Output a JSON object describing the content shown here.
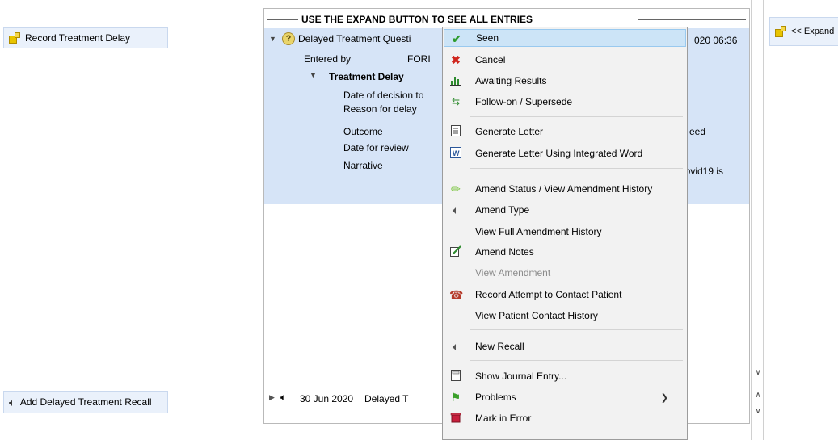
{
  "left_buttons": {
    "record_treatment_delay": "Record Treatment Delay",
    "add_delayed_treatment_recall": "Add Delayed Treatment Recall"
  },
  "right_button": {
    "expand": "<< Expand"
  },
  "panel": {
    "header": "USE THE EXPAND BUTTON TO SEE ALL ENTRIES",
    "entry": {
      "title": "Delayed Treatment Questi",
      "time_fragment": "020 06:36",
      "entered_by_label": "Entered by",
      "entered_by_value": "FORI",
      "section_title": "Treatment Delay",
      "fields": [
        {
          "label": "Date of decision to",
          "value": ""
        },
        {
          "label": "Reason for delay",
          "value": ""
        },
        {
          "label": "Outcome",
          "value": "eed"
        },
        {
          "label": "Date for review",
          "value": ""
        },
        {
          "label": "Narrative",
          "value": "f covid19 is"
        }
      ]
    },
    "bottom_row": {
      "date": "30 Jun 2020",
      "text": "Delayed T"
    }
  },
  "context_menu": {
    "items": [
      {
        "label": "Seen",
        "icon": "check-icon",
        "highlighted": true,
        "disabled": false
      },
      {
        "label": "Cancel",
        "icon": "cross-icon",
        "highlighted": false,
        "disabled": false
      },
      {
        "label": "Awaiting Results",
        "icon": "chart-icon",
        "highlighted": false,
        "disabled": false
      },
      {
        "label": "Follow-on / Supersede",
        "icon": "arrows-icon",
        "highlighted": false,
        "disabled": false
      },
      {
        "label": "Generate Letter",
        "icon": "document-icon",
        "highlighted": false,
        "disabled": false
      },
      {
        "label": "Generate Letter Using Integrated Word",
        "icon": "word-icon",
        "highlighted": false,
        "disabled": false
      },
      {
        "label": "Amend Status / View Amendment History",
        "icon": "pencil-icon",
        "highlighted": false,
        "disabled": false
      },
      {
        "label": "Amend Type",
        "icon": "speaker-tool-icon",
        "highlighted": false,
        "disabled": false
      },
      {
        "label": "View Full Amendment History",
        "icon": "",
        "highlighted": false,
        "disabled": false
      },
      {
        "label": "Amend Notes",
        "icon": "notes-edit-icon",
        "highlighted": false,
        "disabled": false
      },
      {
        "label": "View Amendment",
        "icon": "",
        "highlighted": false,
        "disabled": true
      },
      {
        "label": "Record Attempt to Contact Patient",
        "icon": "phone-icon",
        "highlighted": false,
        "disabled": false
      },
      {
        "label": "View Patient Contact History",
        "icon": "",
        "highlighted": false,
        "disabled": false
      },
      {
        "label": "New Recall",
        "icon": "speaker-icon",
        "highlighted": false,
        "disabled": false
      },
      {
        "label": "Show Journal Entry...",
        "icon": "journal-icon",
        "highlighted": false,
        "disabled": false
      },
      {
        "label": "Problems",
        "icon": "flag-icon",
        "highlighted": false,
        "disabled": false,
        "submenu": true
      },
      {
        "label": "Mark in Error",
        "icon": "bin-icon",
        "highlighted": false,
        "disabled": false
      }
    ]
  }
}
